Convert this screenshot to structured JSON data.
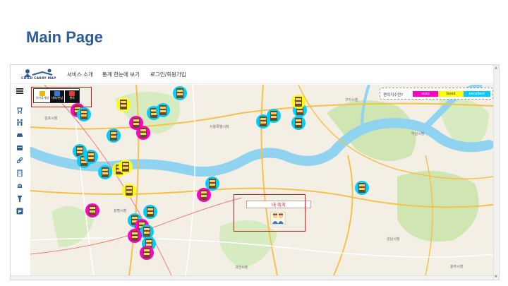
{
  "slide": {
    "title": "Main Page"
  },
  "app": {
    "logo_text": "CHILD CARRY MAP",
    "nav": [
      "서비스 소개",
      "통계 한눈에 보기",
      "로그인/회원가입"
    ]
  },
  "sidebar": {
    "icons": [
      "menu-icon",
      "stroller-icon",
      "family-icon",
      "car-icon",
      "cabinet-icon",
      "link-icon",
      "building-icon",
      "transit-icon",
      "toilet-icon",
      "parking-icon"
    ]
  },
  "filter": {
    "tabs": [
      "유아휴게실",
      "대여/반납",
      "편의"
    ]
  },
  "legend": {
    "title": "편의지수란?",
    "levels": [
      {
        "label": "soso",
        "color": "#ff00cc"
      },
      {
        "label": "Good",
        "color": "#ffff00"
      },
      {
        "label": "excellent",
        "color": "#00ccff"
      }
    ]
  },
  "my_location": {
    "label": "내 위치"
  },
  "map_labels": [
    "서울특별시청",
    "구리시청",
    "광명시청",
    "광주시청",
    "하남시청",
    "과천시청",
    "성남시청",
    "김포시청"
  ],
  "colors": {
    "title": "#2E5C99",
    "highlight": "#d21a1a",
    "river": "#8fd3f0",
    "park": "#cfe6b3",
    "road": "#f6c14b"
  }
}
